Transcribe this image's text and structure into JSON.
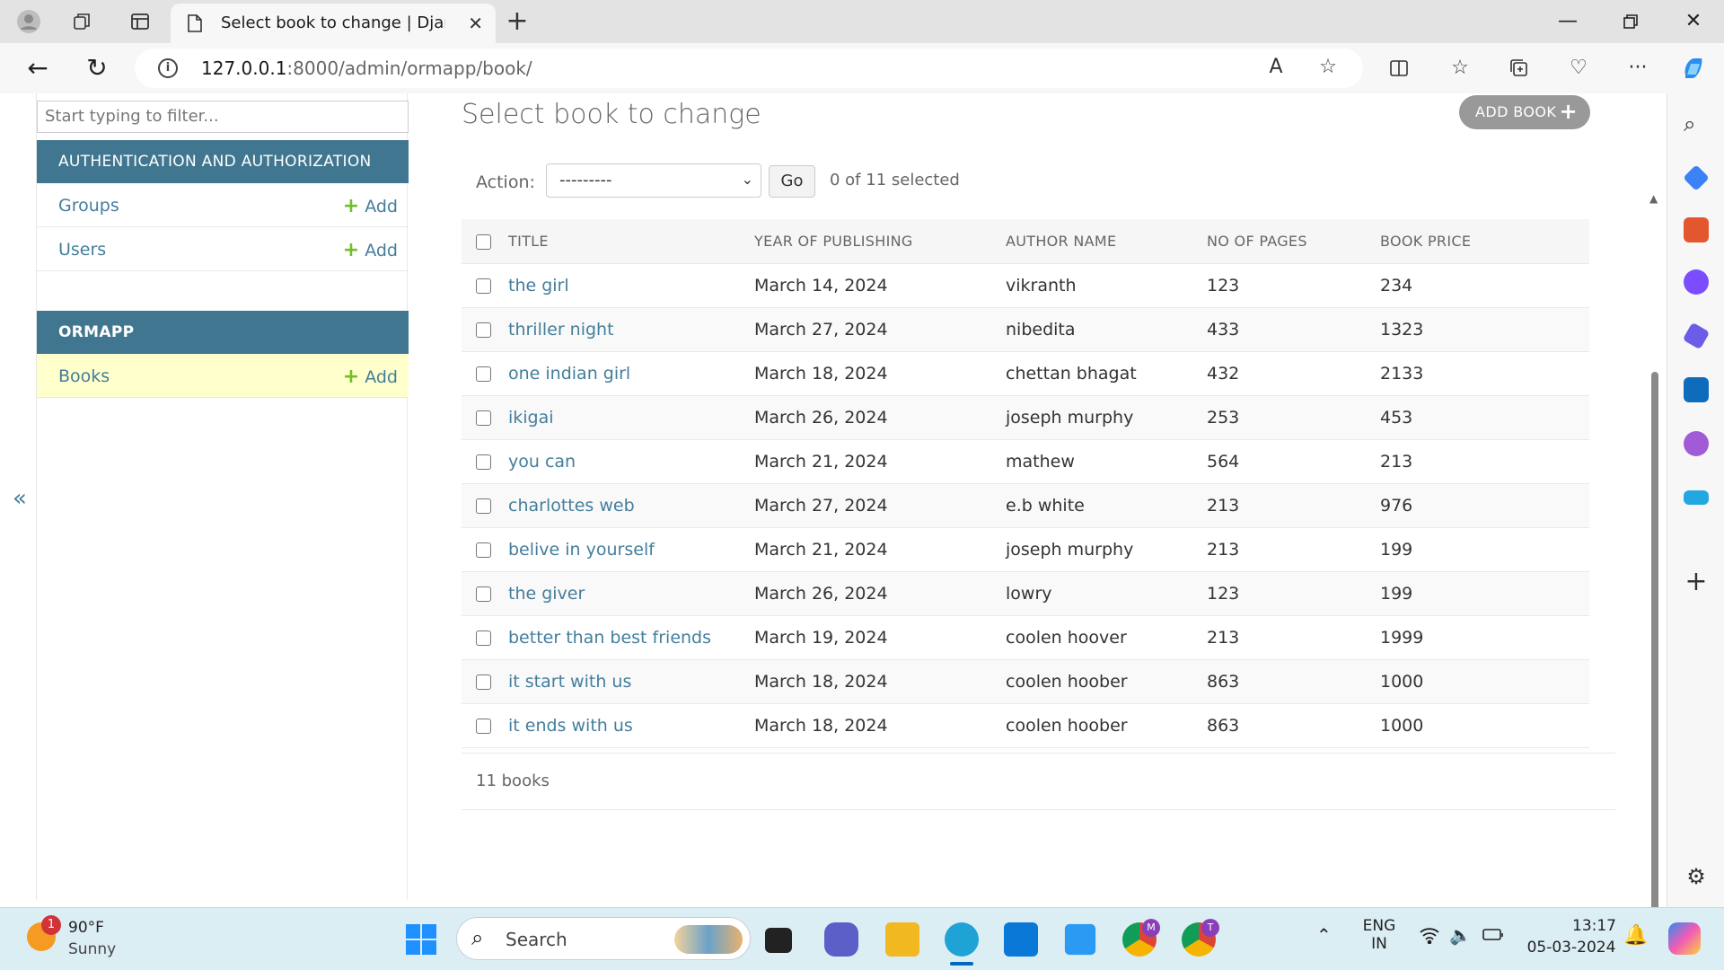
{
  "browser": {
    "tab_title": "Select book to change | Django site admin",
    "url_host": "127.0.0.1",
    "url_path": ":8000/admin/ormapp/book/"
  },
  "sidebar": {
    "filter_placeholder": "Start typing to filter...",
    "modules": [
      {
        "caption": "AUTHENTICATION AND AUTHORIZATION",
        "items": [
          {
            "label": "Groups",
            "add": "Add"
          },
          {
            "label": "Users",
            "add": "Add"
          }
        ]
      },
      {
        "caption": "ORMAPP",
        "items": [
          {
            "label": "Books",
            "add": "Add"
          }
        ]
      }
    ],
    "collapse": "«"
  },
  "content": {
    "title": "Select book to change",
    "add_button": "ADD BOOK",
    "action_label": "Action:",
    "action_selected": "---------",
    "go_button": "Go",
    "selection_count": "0 of 11 selected",
    "columns": [
      "TITLE",
      "YEAR OF PUBLISHING",
      "AUTHOR NAME",
      "NO OF PAGES",
      "BOOK PRICE"
    ],
    "rows": [
      {
        "title": "the girl",
        "year": "March 14, 2024",
        "author": "vikranth",
        "pages": "123",
        "price": "234"
      },
      {
        "title": "thriller night",
        "year": "March 27, 2024",
        "author": "nibedita",
        "pages": "433",
        "price": "1323"
      },
      {
        "title": "one indian girl",
        "year": "March 18, 2024",
        "author": "chettan bhagat",
        "pages": "432",
        "price": "2133"
      },
      {
        "title": "ikigai",
        "year": "March 26, 2024",
        "author": "joseph murphy",
        "pages": "253",
        "price": "453"
      },
      {
        "title": "you can",
        "year": "March 21, 2024",
        "author": "mathew",
        "pages": "564",
        "price": "213"
      },
      {
        "title": "charlottes web",
        "year": "March 27, 2024",
        "author": "e.b white",
        "pages": "213",
        "price": "976"
      },
      {
        "title": "belive in yourself",
        "year": "March 21, 2024",
        "author": "joseph murphy",
        "pages": "213",
        "price": "199"
      },
      {
        "title": "the giver",
        "year": "March 26, 2024",
        "author": "lowry",
        "pages": "123",
        "price": "199"
      },
      {
        "title": "better than best friends",
        "year": "March 19, 2024",
        "author": "coolen hoover",
        "pages": "213",
        "price": "1999"
      },
      {
        "title": "it start with us",
        "year": "March 18, 2024",
        "author": "coolen hoober",
        "pages": "863",
        "price": "1000"
      },
      {
        "title": "it ends with us",
        "year": "March 18, 2024",
        "author": "coolen hoober",
        "pages": "863",
        "price": "1000"
      }
    ],
    "paginator": "11 books"
  },
  "taskbar": {
    "weather_temp": "90°F",
    "weather_cond": "Sunny",
    "weather_badge": "1",
    "search_label": "Search",
    "lang_top": "ENG",
    "lang_bottom": "IN",
    "time": "13:17",
    "date": "05-03-2024",
    "chrome_badge_1": "M",
    "chrome_badge_2": "T"
  },
  "colors": {
    "django_header": "#417690",
    "django_link": "#447e9b",
    "add_green": "#70bf2b",
    "current_row": "#ffffcc"
  }
}
